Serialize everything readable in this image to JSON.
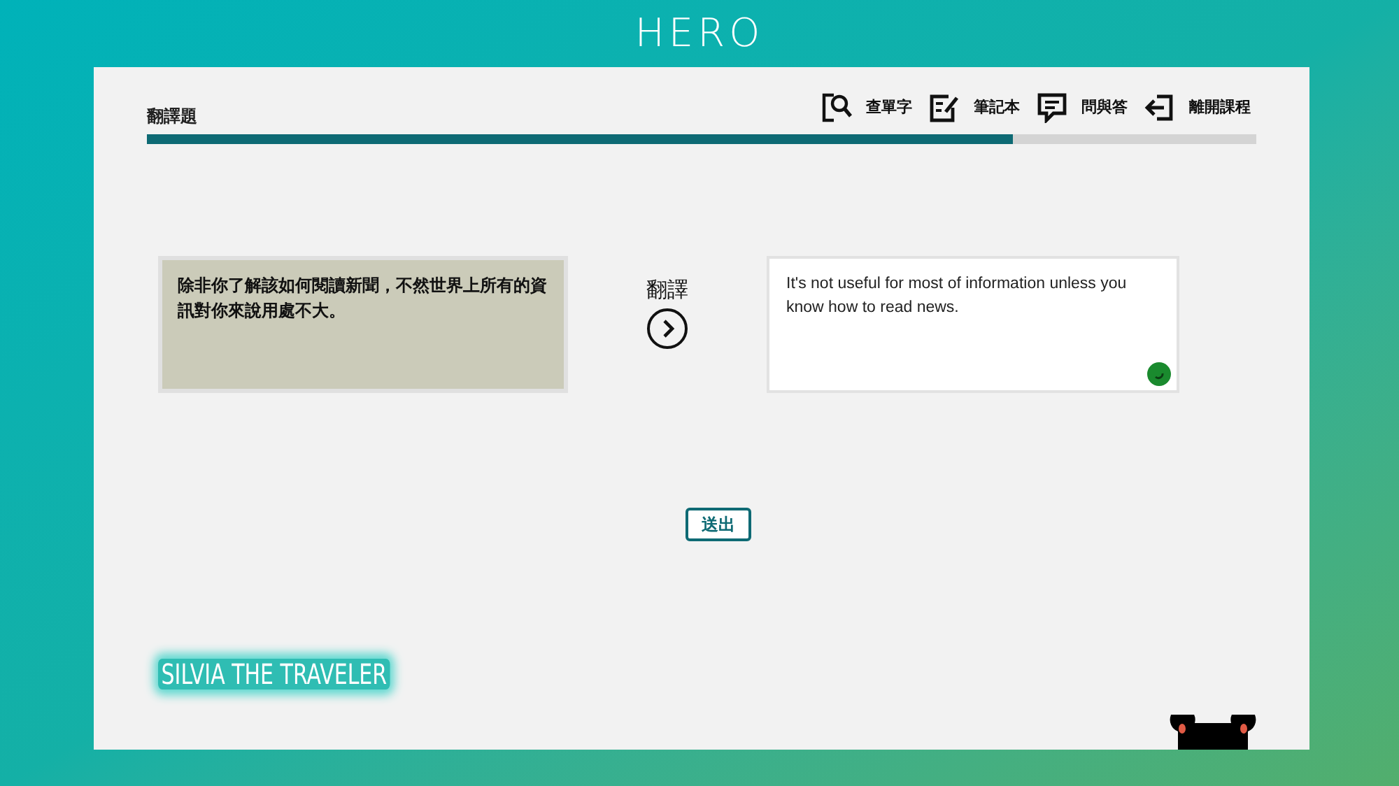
{
  "logo": "HERO",
  "header": {
    "title": "翻譯題",
    "tools": [
      {
        "kind": "lookup",
        "label": "查單字"
      },
      {
        "kind": "notebook",
        "label": "筆記本"
      },
      {
        "kind": "qa",
        "label": "問與答"
      },
      {
        "kind": "exit",
        "label": "離開課程"
      }
    ]
  },
  "progress": {
    "level": 0.78
  },
  "question": {
    "source": "除非你了解該如何閱讀新聞，不然世界上所有的資訊對你來說用處不大。",
    "translate_label": "翻譯",
    "answer": "It's not useful for most of information unless you know how to read news."
  },
  "submit": "送出",
  "brand": "SILVIA THE TRAVELER"
}
